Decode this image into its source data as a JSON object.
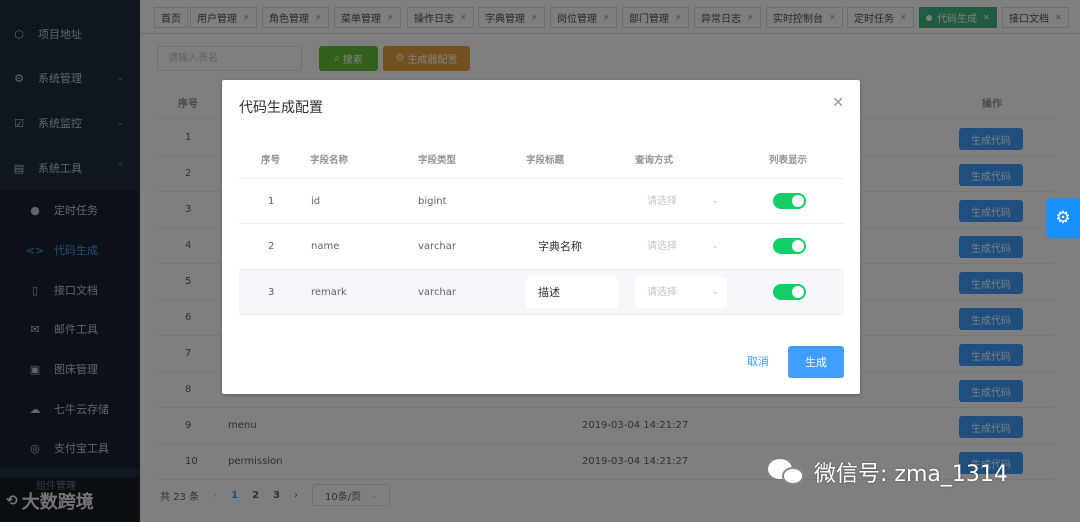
{
  "sidebar": {
    "items": [
      {
        "label": "项目地址",
        "icon": "⬡"
      },
      {
        "label": "系统管理",
        "icon": "⚙"
      },
      {
        "label": "系统监控",
        "icon": "☑"
      },
      {
        "label": "系统工具",
        "icon": "▤"
      }
    ],
    "sub_items": [
      {
        "label": "定时任务",
        "icon": "●"
      },
      {
        "label": "代码生成",
        "icon": "<>"
      },
      {
        "label": "接口文档",
        "icon": "▯"
      },
      {
        "label": "邮件工具",
        "icon": "✉"
      },
      {
        "label": "图床管理",
        "icon": "▣"
      },
      {
        "label": "七牛云存储",
        "icon": "☁"
      },
      {
        "label": "支付宝工具",
        "icon": "◎"
      }
    ],
    "footer_under": "组件管理",
    "footer_brand": "大数跨境"
  },
  "tabs": [
    {
      "label": "首页"
    },
    {
      "label": "用户管理"
    },
    {
      "label": "角色管理"
    },
    {
      "label": "菜单管理"
    },
    {
      "label": "操作日志"
    },
    {
      "label": "字典管理"
    },
    {
      "label": "岗位管理"
    },
    {
      "label": "部门管理"
    },
    {
      "label": "异常日志"
    },
    {
      "label": "实时控制台"
    },
    {
      "label": "定时任务"
    },
    {
      "label": "代码生成"
    },
    {
      "label": "接口文档"
    }
  ],
  "toolbar": {
    "search_placeholder": "请输入表名",
    "search_label": "搜索",
    "gen_config_label": "生成器配置"
  },
  "table": {
    "headers": {
      "index": "序号",
      "ops": "操作"
    },
    "rows": [
      {
        "index": "1",
        "name": "",
        "time": ""
      },
      {
        "index": "2",
        "name": "",
        "time": ""
      },
      {
        "index": "3",
        "name": "",
        "time": ""
      },
      {
        "index": "4",
        "name": "",
        "time": ""
      },
      {
        "index": "5",
        "name": "",
        "time": ""
      },
      {
        "index": "6",
        "name": "",
        "time": ""
      },
      {
        "index": "7",
        "name": "",
        "time": ""
      },
      {
        "index": "8",
        "name": "",
        "time": ""
      },
      {
        "index": "9",
        "name": "menu",
        "time": "2019-03-04 14:21:27"
      },
      {
        "index": "10",
        "name": "permission",
        "time": "2019-03-04 14:21:27"
      }
    ],
    "row_button": "生成代码"
  },
  "pager": {
    "total": "共 23 条",
    "pages": [
      "1",
      "2",
      "3"
    ],
    "page_size": "10条/页"
  },
  "modal": {
    "title": "代码生成配置",
    "headers": {
      "index": "序号",
      "field_name": "字段名称",
      "field_type": "字段类型",
      "field_title": "字段标题",
      "query": "查询方式",
      "list_show": "列表显示"
    },
    "rows": [
      {
        "index": "1",
        "name": "id",
        "type": "bigint",
        "title": "",
        "query_placeholder": "请选择"
      },
      {
        "index": "2",
        "name": "name",
        "type": "varchar",
        "title": "字典名称",
        "query_placeholder": "请选择"
      },
      {
        "index": "3",
        "name": "remark",
        "type": "varchar",
        "title": "描述",
        "query_placeholder": "请选择"
      }
    ],
    "cancel_label": "取消",
    "generate_label": "生成"
  },
  "watermark": "微信号: zma_1314",
  "colors": {
    "primary": "#409eff",
    "success": "#67c23a",
    "warning": "#e6a23c",
    "active_tab": "#42b983",
    "switch_on": "#13ce66",
    "sidebar_bg": "#1f2d3d"
  }
}
